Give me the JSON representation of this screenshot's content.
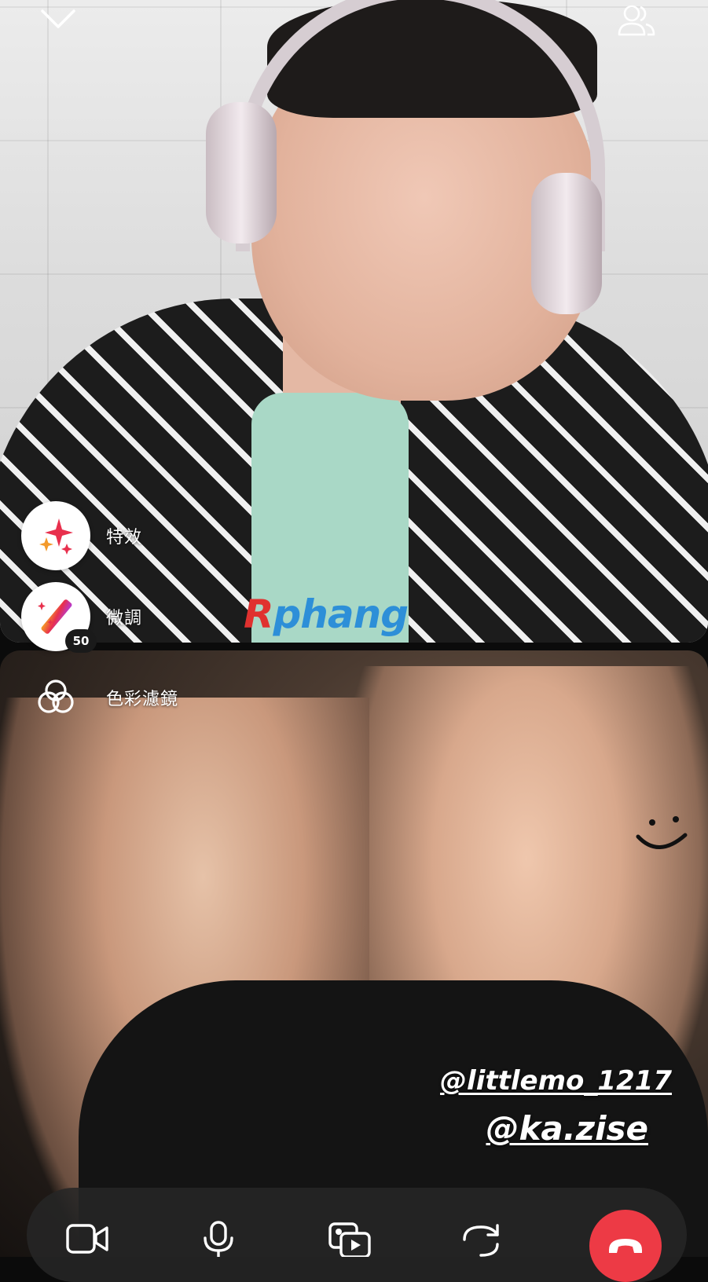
{
  "effects_menu": {
    "items": [
      {
        "label": "特效",
        "icon": "sparkles-icon"
      },
      {
        "label": "微調",
        "icon": "magic-wand-icon",
        "badge": "50"
      },
      {
        "label": "色彩濾鏡",
        "icon": "color-filter-icon"
      }
    ]
  },
  "watermark": {
    "first_letter": "R",
    "rest": "phang"
  },
  "mentions": [
    "@littlemo_1217",
    "@ka.zise"
  ],
  "top_bar": {
    "collapse_icon": "chevron-down-icon",
    "participants_icon": "people-icon"
  },
  "controls": {
    "icons": [
      "video-camera-icon",
      "microphone-icon",
      "media-share-icon",
      "flip-camera-icon",
      "end-call-icon"
    ]
  },
  "colors": {
    "end_call": "#ed3a45",
    "control_bar": "#262626",
    "watermark_red": "#e0312f",
    "watermark_blue": "#2d8fd8"
  }
}
